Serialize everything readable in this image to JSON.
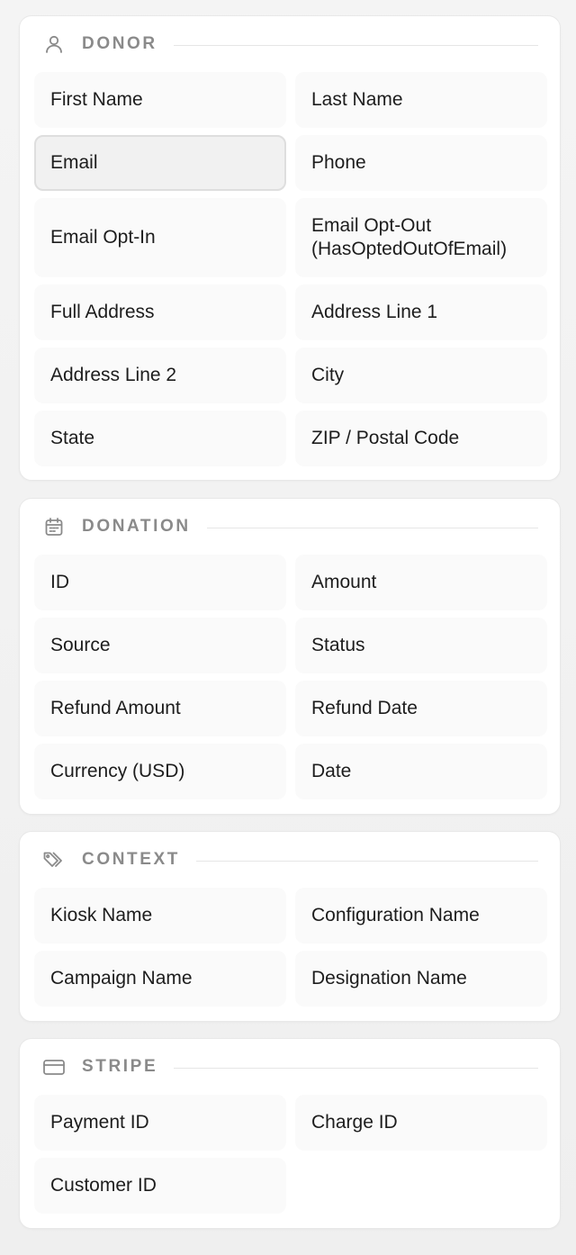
{
  "sections": {
    "donor": {
      "title": "DONOR",
      "icon": "user-icon",
      "fields": {
        "first_name": "First Name",
        "last_name": "Last Name",
        "email": "Email",
        "phone": "Phone",
        "email_opt_in": "Email Opt-In",
        "email_opt_out": "Email Opt-Out (HasOptedOutOfEmail)",
        "full_address": "Full Address",
        "address_line_1": "Address Line 1",
        "address_line_2": "Address Line 2",
        "city": "City",
        "state": "State",
        "zip": "ZIP / Postal Code"
      },
      "selected_field": "Email"
    },
    "donation": {
      "title": "DONATION",
      "icon": "calendar-icon",
      "fields": {
        "id": "ID",
        "amount": "Amount",
        "source": "Source",
        "status": "Status",
        "refund_amount": "Refund Amount",
        "refund_date": "Refund Date",
        "currency": "Currency (USD)",
        "date": "Date"
      }
    },
    "context": {
      "title": "CONTEXT",
      "icon": "tags-icon",
      "fields": {
        "kiosk_name": "Kiosk Name",
        "configuration_name": "Configuration Name",
        "campaign_name": "Campaign Name",
        "designation_name": "Designation Name"
      }
    },
    "stripe": {
      "title": "STRIPE",
      "icon": "credit-card-icon",
      "fields": {
        "payment_id": "Payment ID",
        "charge_id": "Charge ID",
        "customer_id": "Customer ID"
      }
    }
  },
  "colors": {
    "section_title": "#8a8a8a",
    "field_bg": "#fafafa",
    "selected_field_bg": "#f1f1f1",
    "selected_field_border": "#dedede"
  }
}
